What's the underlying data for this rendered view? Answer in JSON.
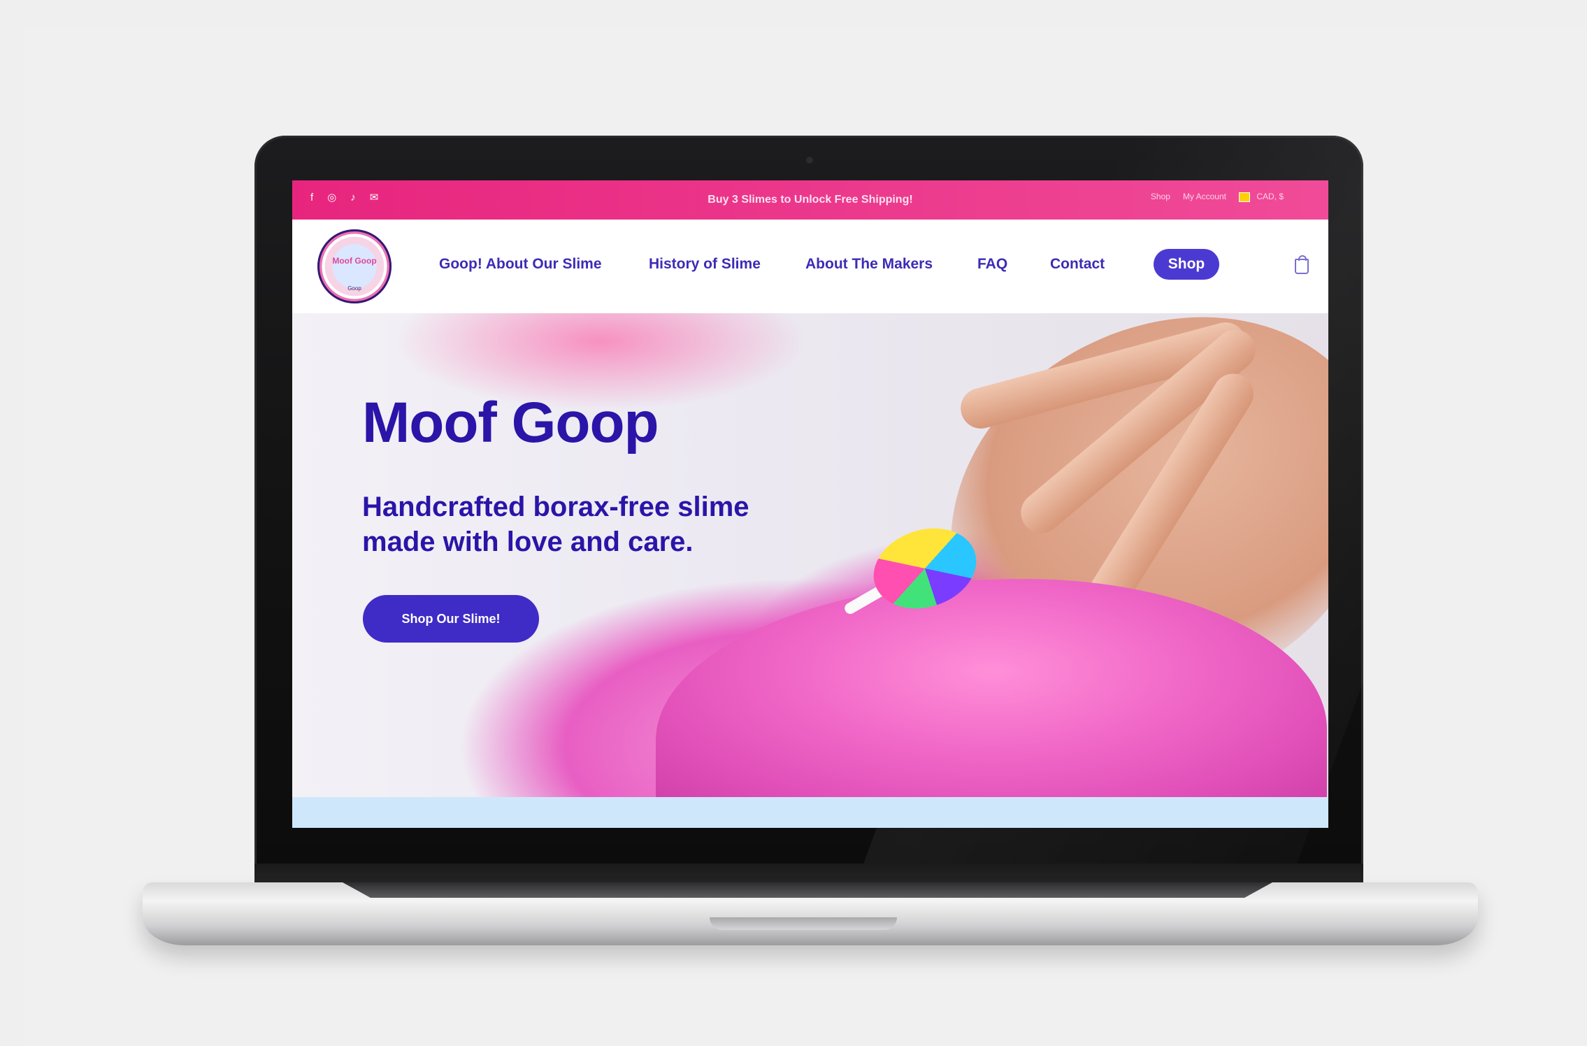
{
  "announcement": {
    "social_icons": [
      "facebook-icon",
      "instagram-icon",
      "tiktok-icon",
      "email-icon"
    ],
    "text": "Buy 3 Slimes to Unlock Free Shipping!",
    "shop_link": "Shop",
    "account_link": "My Account",
    "currency": "CAD, $"
  },
  "header": {
    "logo_text": "Moof Goop",
    "logo_subtext": "Goop",
    "nav": [
      "Goop! About Our Slime",
      "History of Slime",
      "About The Makers",
      "FAQ",
      "Contact"
    ],
    "shop_button": "Shop"
  },
  "hero": {
    "title": "Moof Goop",
    "subtitle": "Handcrafted borax-free slime made with love and care.",
    "cta": "Shop Our Slime!"
  },
  "colors": {
    "announcement_bg": "#e8257e",
    "brand_purple": "#3f2bc6",
    "strip": "#cfe7fb"
  }
}
